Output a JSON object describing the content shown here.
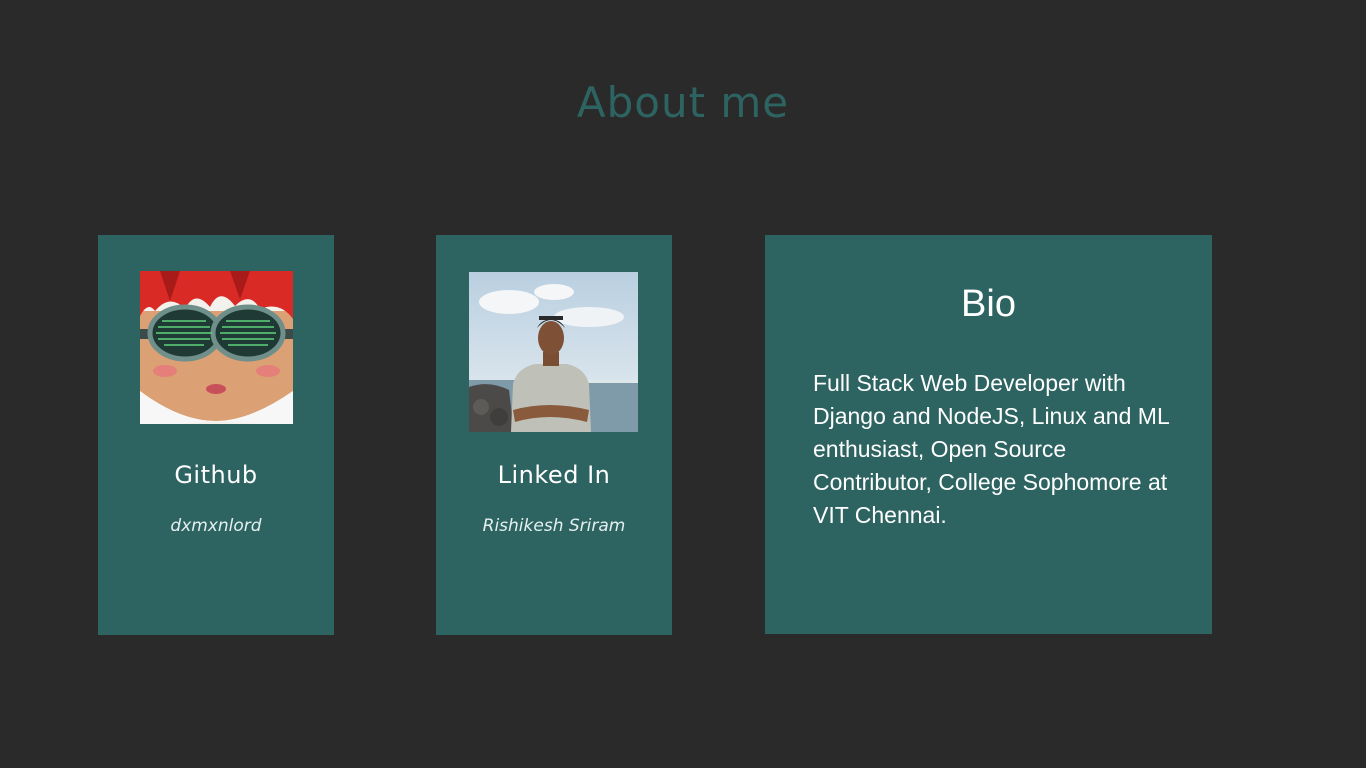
{
  "page": {
    "title": "About me"
  },
  "cards": {
    "github": {
      "title": "Github",
      "subtitle": "dxmxnlord",
      "image_icon": "anime-avatar-goggles"
    },
    "linkedin": {
      "title": "Linked In",
      "subtitle": "Rishikesh Sriram",
      "image_icon": "profile-photo"
    },
    "bio": {
      "title": "Bio",
      "text": "Full Stack Web Developer with Django and NodeJS, Linux and ML enthusiast, Open Source Contributor, College Sophomore at VIT Chennai."
    }
  },
  "colors": {
    "background": "#2a2a2a",
    "card": "#2d6461",
    "heading": "#2d6461",
    "text": "#ffffff"
  }
}
